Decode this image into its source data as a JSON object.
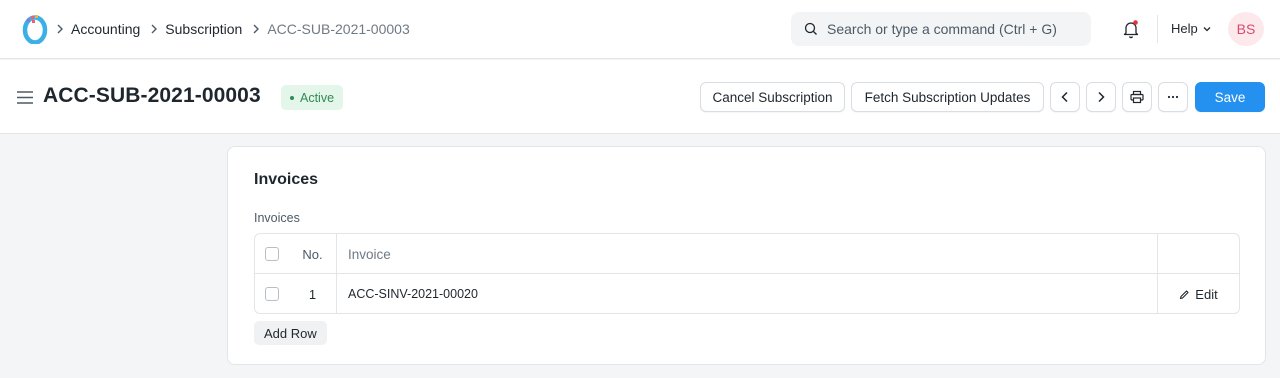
{
  "navbar": {
    "breadcrumbs": [
      "Accounting",
      "Subscription",
      "ACC-SUB-2021-00003"
    ],
    "search_placeholder": "Search or type a command (Ctrl + G)",
    "help_label": "Help",
    "avatar_initials": "BS"
  },
  "page": {
    "title": "ACC-SUB-2021-00003",
    "status": "Active",
    "status_color": "#2e8c54",
    "actions": {
      "cancel": "Cancel Subscription",
      "fetch": "Fetch Subscription Updates",
      "save": "Save"
    }
  },
  "section": {
    "title": "Invoices",
    "field_label": "Invoices",
    "columns": {
      "no": "No.",
      "invoice": "Invoice"
    },
    "rows": [
      {
        "no": "1",
        "invoice": "ACC-SINV-2021-00020",
        "edit": "Edit"
      }
    ],
    "add_row": "Add Row"
  },
  "colors": {
    "accent": "#2490ef",
    "avatar_bg": "#fde8ec"
  }
}
